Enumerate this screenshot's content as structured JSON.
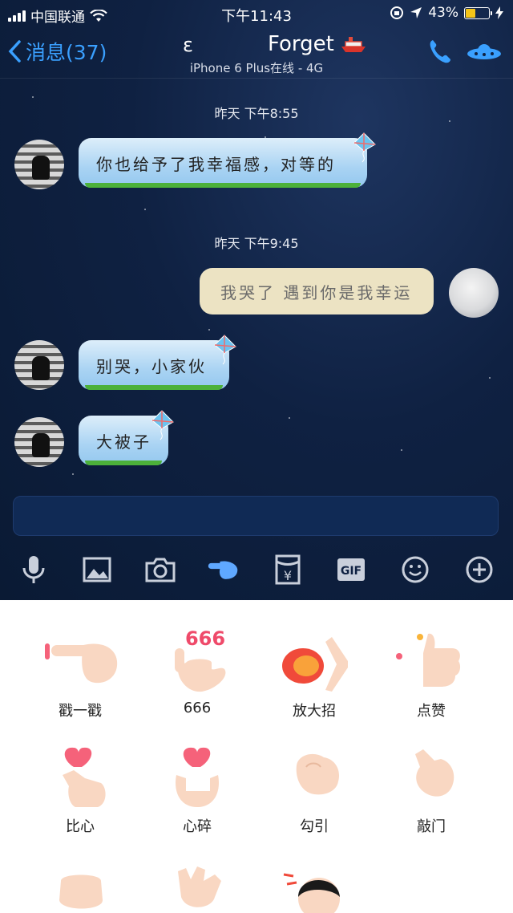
{
  "status_bar": {
    "carrier": "中国联通",
    "time": "下午11:43",
    "battery": "43%"
  },
  "nav": {
    "back_label": "消息(37)",
    "left_name": "ε",
    "title": "Forget",
    "subtitle": "iPhone 6 Plus在线 - 4G"
  },
  "chat": {
    "timestamps": [
      "昨天 下午8:55",
      "昨天 下午9:45"
    ],
    "messages": [
      {
        "from": "other",
        "text": "你也给予了我幸福感，对等的"
      },
      {
        "from": "me",
        "text": "我哭了 遇到你是我幸运"
      },
      {
        "from": "other",
        "text": "别哭，小家伙"
      },
      {
        "from": "other",
        "text": "大被子"
      }
    ]
  },
  "composer": {
    "value": ""
  },
  "toolbar": {
    "icons": [
      "microphone-icon",
      "image-icon",
      "camera-icon",
      "poke-hand-icon",
      "red-packet-icon",
      "gif-icon",
      "emoji-icon",
      "plus-icon"
    ],
    "gif_label": "GIF",
    "yuan_label": "¥"
  },
  "actions": {
    "items": [
      {
        "label": "戳一戳",
        "icon": "poke-icon"
      },
      {
        "label": "666",
        "icon": "666-hand-icon",
        "badge": "666"
      },
      {
        "label": "放大招",
        "icon": "fireball-hand-icon"
      },
      {
        "label": "点赞",
        "icon": "thumbs-up-icon"
      },
      {
        "label": "比心",
        "icon": "finger-heart-icon"
      },
      {
        "label": "心碎",
        "icon": "heart-break-icon"
      },
      {
        "label": "勾引",
        "icon": "beckon-hand-icon"
      },
      {
        "label": "敲门",
        "icon": "knock-hand-icon"
      },
      {
        "label": "",
        "icon": "fist-icon"
      },
      {
        "label": "",
        "icon": "pinch-hand-icon"
      },
      {
        "label": "",
        "icon": "head-bonk-icon"
      }
    ]
  },
  "colors": {
    "accent": "#3aa0ff",
    "chat_bg": "#0f2142",
    "bubble_blue": "#a9d3f3",
    "bubble_me": "#ece3c3",
    "battery": "#f5c518"
  }
}
